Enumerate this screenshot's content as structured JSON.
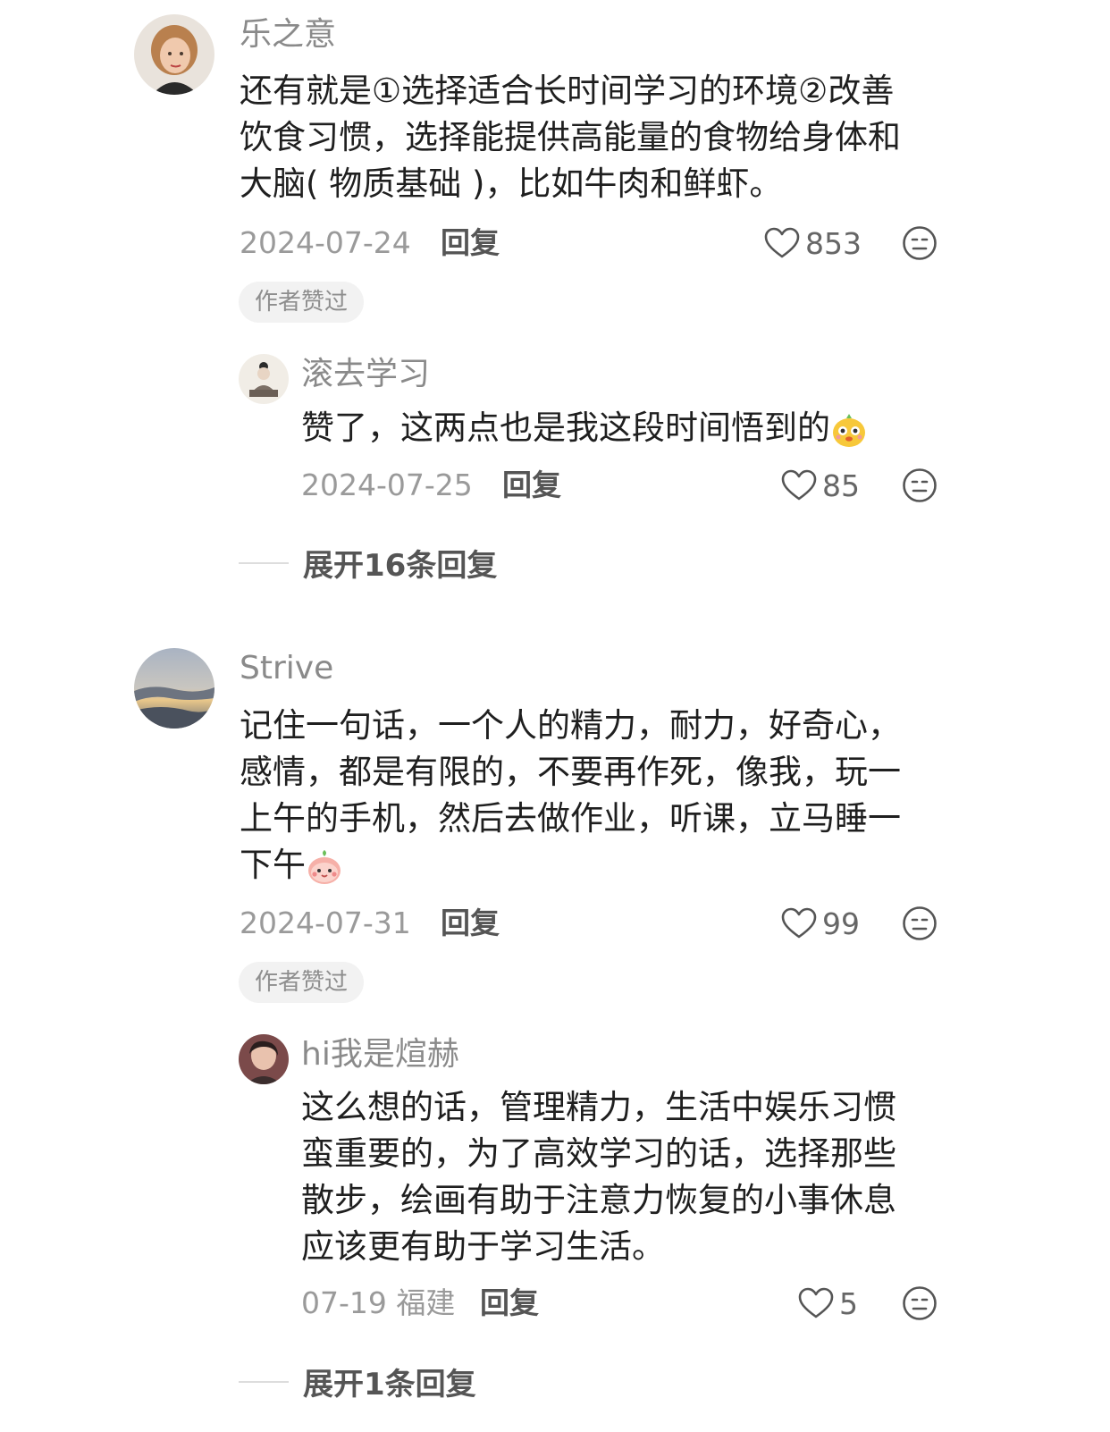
{
  "comments": [
    {
      "username": "乐之意",
      "text_lines": [
        "还有就是①选择适合长时间学习的环境②改善",
        "饮食习惯，选择能提供高能量的食物给身体和",
        "大脑( 物质基础 )，比如牛肉和鲜虾。"
      ],
      "date": "2024-07-24",
      "reply_label": "回复",
      "likes": "853",
      "badge": "作者赞过",
      "reply": {
        "username": "滚去学习",
        "text": "赞了，这两点也是我这段时间悟到的",
        "emoji_icon": "yellow-chick-emoji-icon",
        "date": "2024-07-25",
        "reply_label": "回复",
        "likes": "85"
      },
      "expand_label": "展开16条回复"
    },
    {
      "username": "Strive",
      "text_lines": [
        "记住一句话，一个人的精力，耐力，好奇心，",
        "感情，都是有限的，不要再作死，像我，玩一",
        "上午的手机，然后去做作业，听课，立马睡一",
        "下午"
      ],
      "emoji_icon": "peach-face-emoji-icon",
      "date": "2024-07-31",
      "reply_label": "回复",
      "likes": "99",
      "badge": "作者赞过",
      "reply": {
        "username": "hi我是煊赫",
        "text_lines": [
          "这么想的话，管理精力，生活中娱乐习惯",
          "蛮重要的，为了高效学习的话，选择那些",
          "散步，绘画有助于注意力恢复的小事休息",
          "应该更有助于学习生活。"
        ],
        "date": "07-19 福建",
        "reply_label": "回复",
        "likes": "5"
      },
      "expand_label": "展开1条回复"
    }
  ],
  "icons": {
    "like": "heart-outline-icon",
    "dislike": "meh-face-icon"
  },
  "colors": {
    "username": "#8a8a8a",
    "text": "#1f1f1f",
    "meta": "#9a9a9a",
    "badge_bg": "#f2f2f2"
  }
}
